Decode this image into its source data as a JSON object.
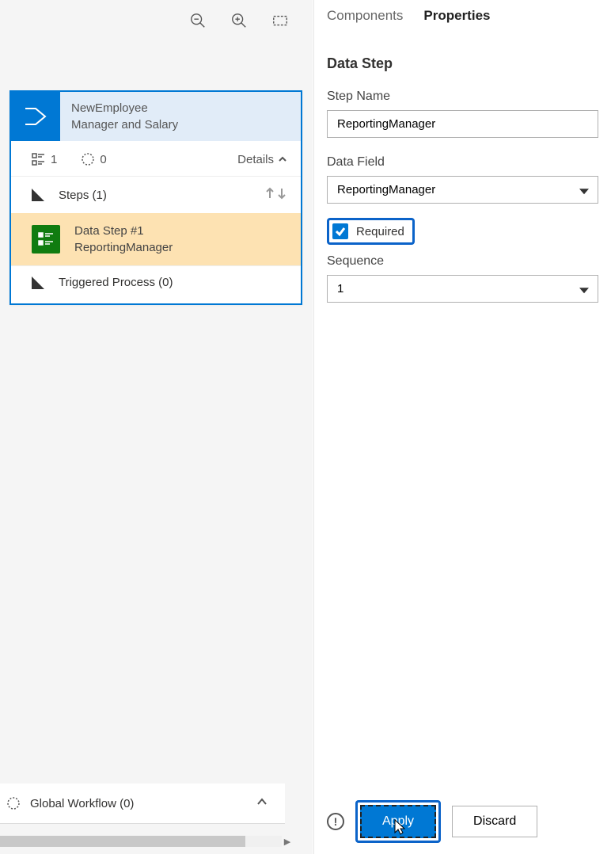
{
  "canvas": {
    "card": {
      "title_line1": "NewEmployee",
      "title_line2": "Manager and Salary",
      "meta_count1": "1",
      "meta_count2": "0",
      "details_label": "Details",
      "steps_label": "Steps (1)",
      "step_title": "Data Step #1",
      "step_sub": "ReportingManager",
      "triggered_label": "Triggered Process (0)"
    },
    "global_workflow_label": "Global Workflow (0)"
  },
  "panel": {
    "tabs": {
      "components": "Components",
      "properties": "Properties"
    },
    "section_title": "Data Step",
    "step_name_label": "Step Name",
    "step_name_value": "ReportingManager",
    "data_field_label": "Data Field",
    "data_field_value": "ReportingManager",
    "required_label": "Required",
    "sequence_label": "Sequence",
    "sequence_value": "1",
    "apply_label": "Apply",
    "discard_label": "Discard"
  }
}
